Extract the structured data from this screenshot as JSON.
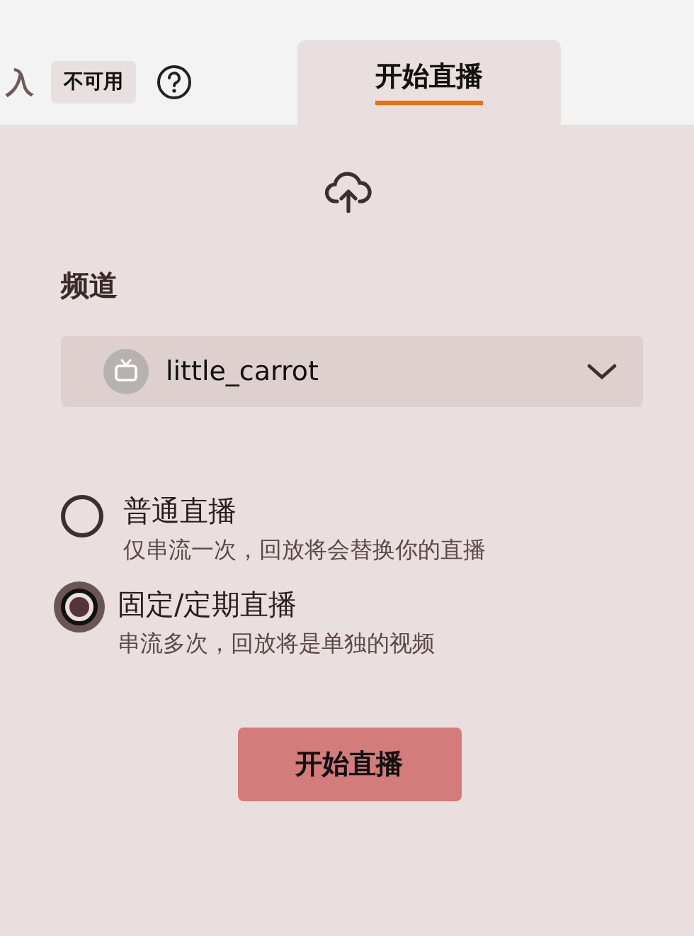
{
  "tabs": [
    {
      "label": "入",
      "selected": false,
      "badge": "不可用"
    },
    {
      "label": "开始直播",
      "selected": true
    }
  ],
  "channel": {
    "label": "频道",
    "value": "little_carrot"
  },
  "modes": [
    {
      "title": "普通直播",
      "description": "仅串流一次，回放将会替换你的直播",
      "selected": false
    },
    {
      "title": "固定/定期直播",
      "description": "串流多次，回放将是单独的视频",
      "selected": true
    }
  ],
  "button": "开始直播"
}
